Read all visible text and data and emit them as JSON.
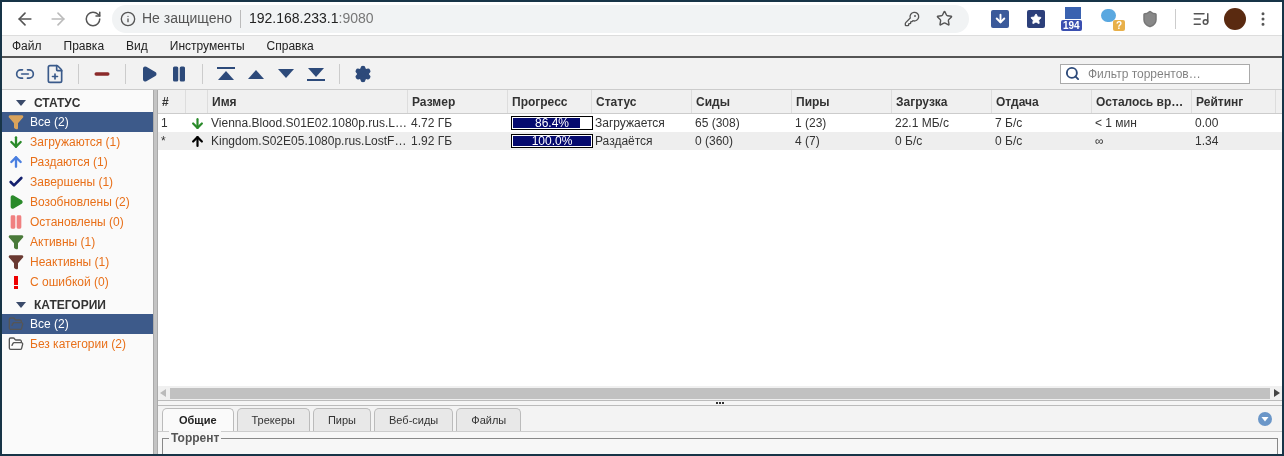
{
  "browser": {
    "security_label": "Не защищено",
    "url_host": "192.168.233.1",
    "url_port": ":9080",
    "extension_badges": [
      {
        "kind": "count",
        "text": "194"
      },
      {
        "kind": "unknown",
        "text": "?"
      }
    ]
  },
  "menu": [
    "Файл",
    "Правка",
    "Вид",
    "Инструменты",
    "Справка"
  ],
  "toolbar": {
    "filter_placeholder": "Фильтр торрентов…"
  },
  "sidebar": {
    "sections": [
      {
        "title": "СТАТУС",
        "expanded": true,
        "items": [
          {
            "label": "Все (2)",
            "kind": "all",
            "selected": true
          },
          {
            "label": "Загружаются (1)",
            "kind": "downloading",
            "selected": false
          },
          {
            "label": "Раздаются (1)",
            "kind": "seeding",
            "selected": false
          },
          {
            "label": "Завершены (1)",
            "kind": "completed",
            "selected": false
          },
          {
            "label": "Возобновлены (2)",
            "kind": "resumed",
            "selected": false
          },
          {
            "label": "Остановлены (0)",
            "kind": "paused",
            "selected": false
          },
          {
            "label": "Активны (1)",
            "kind": "active",
            "selected": false
          },
          {
            "label": "Неактивны (1)",
            "kind": "inactive",
            "selected": false
          },
          {
            "label": "С ошибкой (0)",
            "kind": "errored",
            "selected": false
          }
        ]
      },
      {
        "title": "КАТЕГОРИИ",
        "expanded": true,
        "items": [
          {
            "label": "Все (2)",
            "kind": "folder",
            "selected": true
          },
          {
            "label": "Без категории (2)",
            "kind": "folder",
            "selected": false
          }
        ]
      }
    ]
  },
  "table": {
    "columns": [
      "#",
      "Имя",
      "Размер",
      "Прогресс",
      "Статус",
      "Сиды",
      "Пиры",
      "Загрузка",
      "Отдача",
      "Осталось вр…",
      "Рейтинг"
    ],
    "rows": [
      {
        "index": "1",
        "kind": "downloading",
        "name": "Vienna.Blood.S01E02.1080p.rus.L…",
        "size": "4.72 ГБ",
        "progress": "86.4%",
        "level": 0.864,
        "status": "Загружается",
        "seeds": "65 (308)",
        "peers": "1 (23)",
        "download": "22.1 МБ/с",
        "upload": "7 Б/с",
        "eta": "< 1 мин",
        "ratio": "0.00"
      },
      {
        "index": "*",
        "kind": "seeding",
        "name": "Kingdom.S02E05.1080p.rus.LostF…",
        "size": "1.92 ГБ",
        "progress": "100.0%",
        "level": 1,
        "status": "Раздаётся",
        "seeds": "0 (360)",
        "peers": "4 (7)",
        "download": "0 Б/с",
        "upload": "0 Б/с",
        "eta": "∞",
        "ratio": "1.34"
      }
    ]
  },
  "details": {
    "tabs": [
      {
        "label": "Общие",
        "selected": true
      },
      {
        "label": "Трекеры",
        "selected": false
      },
      {
        "label": "Пиры",
        "selected": false
      },
      {
        "label": "Веб-сиды",
        "selected": false
      },
      {
        "label": "Файлы",
        "selected": false
      }
    ],
    "group_title": "Торрент"
  }
}
